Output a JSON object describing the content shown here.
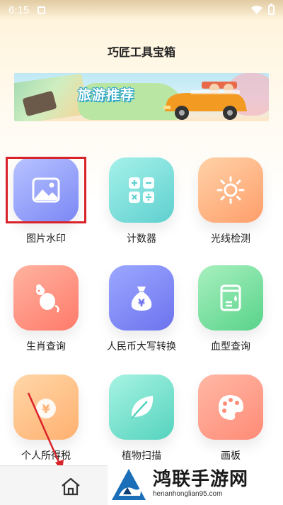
{
  "status_bar": {
    "time": "6:15"
  },
  "header": {
    "title": "巧匠工具宝箱"
  },
  "banner": {
    "text": "旅游推荐"
  },
  "tools": [
    {
      "label": "图片水印",
      "icon": "image-icon"
    },
    {
      "label": "计数器",
      "icon": "calculator-icon"
    },
    {
      "label": "光线检测",
      "icon": "sun-icon"
    },
    {
      "label": "生肖查询",
      "icon": "rat-icon"
    },
    {
      "label": "人民币大写转换",
      "icon": "money-bag-icon"
    },
    {
      "label": "血型查询",
      "icon": "blood-report-icon"
    },
    {
      "label": "个人所得税",
      "icon": "yen-coin-icon"
    },
    {
      "label": "植物扫描",
      "icon": "leaf-icon"
    },
    {
      "label": "画板",
      "icon": "palette-icon"
    }
  ],
  "bottom_nav": {
    "home_icon": "home-icon"
  },
  "watermark": {
    "title": "鸿联手游网",
    "url": "henanhonglian95.com"
  },
  "colors": {
    "highlight": "#d9232a",
    "accent_blue": "#7b87f5"
  }
}
